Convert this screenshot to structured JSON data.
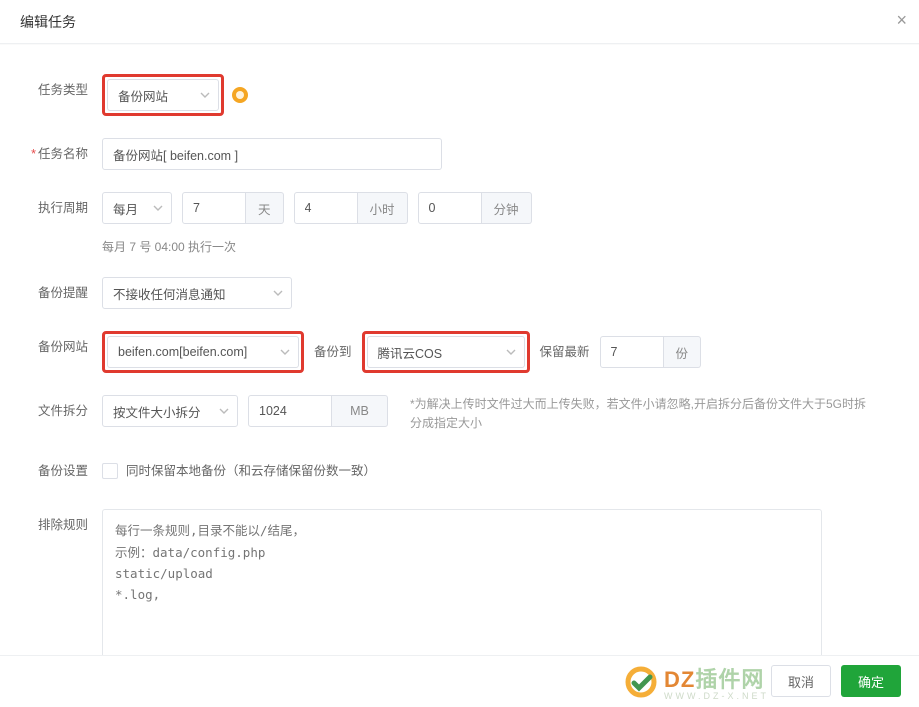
{
  "header": {
    "title": "编辑任务"
  },
  "fields": {
    "task_type": {
      "label": "任务类型",
      "value": "备份网站"
    },
    "task_name": {
      "label": "任务名称",
      "value": "备份网站[ beifen.com ]",
      "required": true
    },
    "period": {
      "label": "执行周期",
      "freq": "每月",
      "day": "7",
      "day_unit": "天",
      "hour": "4",
      "hour_unit": "小时",
      "minute": "0",
      "minute_unit": "分钟",
      "hint": "每月 7 号 04:00 执行一次"
    },
    "notify": {
      "label": "备份提醒",
      "value": "不接收任何消息通知"
    },
    "site": {
      "label": "备份网站",
      "value": "beifen.com[beifen.com]"
    },
    "dest": {
      "label": "备份到",
      "value": "腾讯云COS"
    },
    "keep": {
      "label": "保留最新",
      "value": "7",
      "unit": "份"
    },
    "split": {
      "label": "文件拆分",
      "mode": "按文件大小拆分",
      "size": "1024",
      "unit": "MB",
      "note": "*为解决上传时文件过大而上传失败，若文件小请忽略,开启拆分后备份文件大于5G时拆分成指定大小"
    },
    "setting": {
      "label": "备份设置",
      "checkbox_label": "同时保留本地备份（和云存储保留份数一致）"
    },
    "exclude": {
      "label": "排除规则",
      "placeholder": "每行一条规则,目录不能以/结尾，\n示例：data/config.php\nstatic/upload\n*.log,"
    }
  },
  "footer": {
    "cancel": "取消",
    "ok": "确定"
  },
  "watermark": {
    "brand_a": "DZ",
    "brand_b": "插件网",
    "sub": "WWW.DZ-X.NET"
  }
}
